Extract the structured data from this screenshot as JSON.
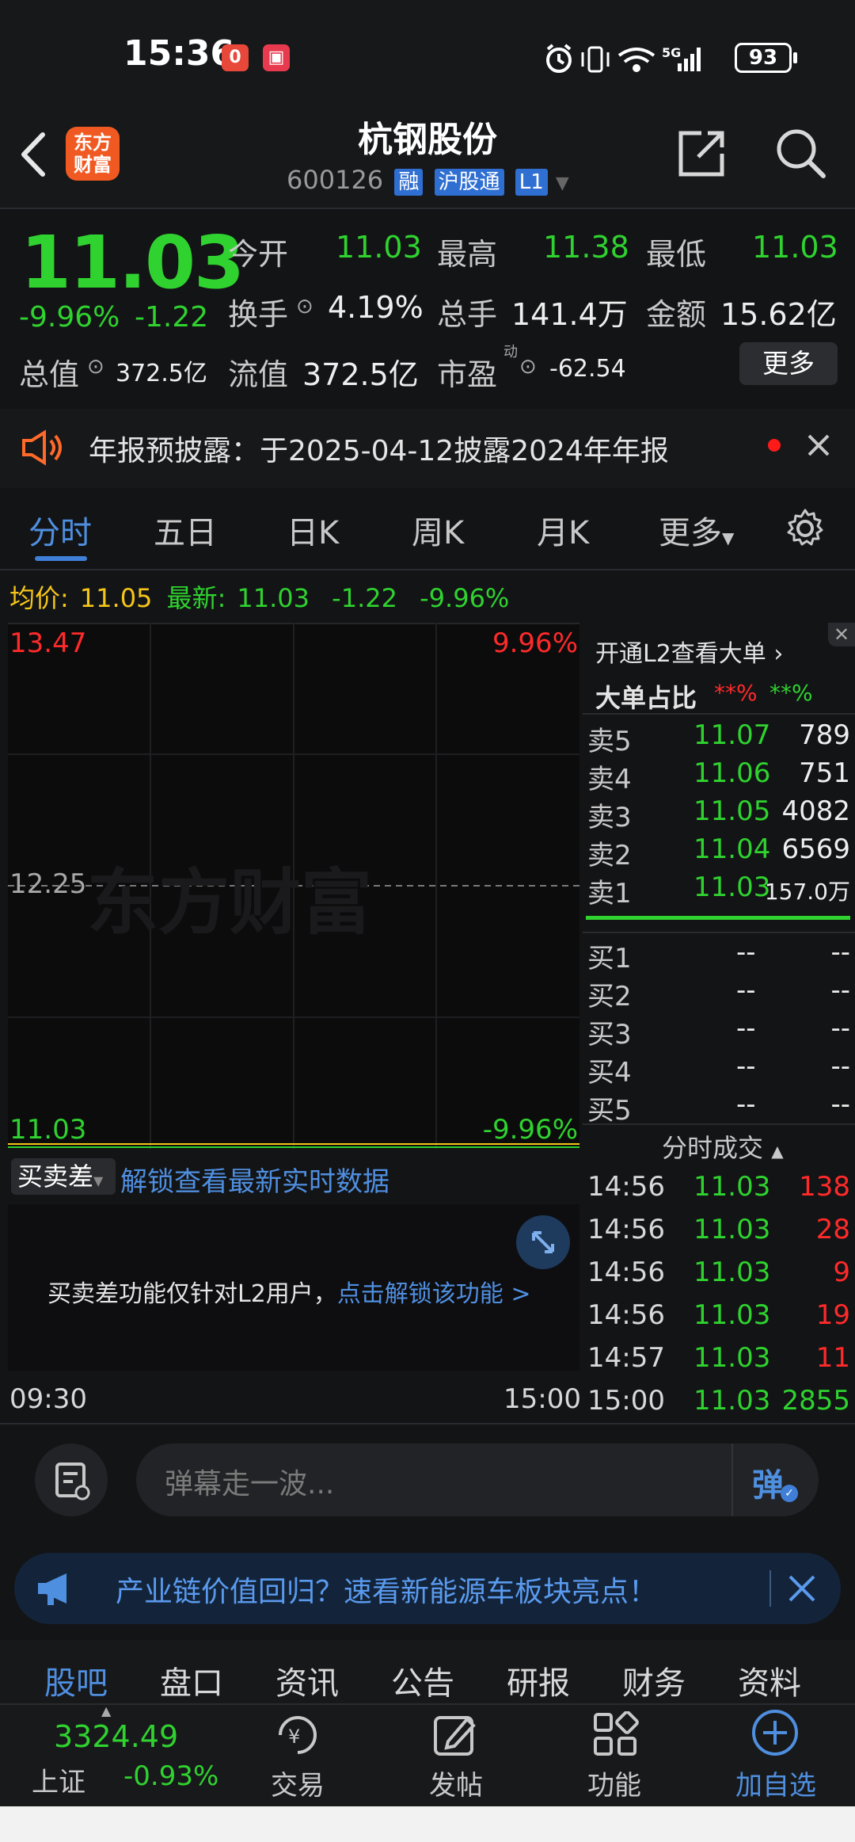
{
  "status": {
    "time": "15:36",
    "battery": "93",
    "network": "5G"
  },
  "header": {
    "title": "杭钢股份",
    "code": "600126",
    "tags": [
      "融",
      "沪股通",
      "L1"
    ],
    "logo_line1": "东方",
    "logo_line2": "财富"
  },
  "quote": {
    "price": "11.03",
    "change_pct": "-9.96%",
    "change": "-1.22",
    "open_label": "今开",
    "open": "11.03",
    "high_label": "最高",
    "high": "11.38",
    "low_label": "最低",
    "low": "11.03",
    "turnover_label": "换手",
    "turnover": "4.19%",
    "volume_label": "总手",
    "volume": "141.4万",
    "amount_label": "金额",
    "amount": "15.62亿",
    "mktcap_label": "总值",
    "mktcap": "372.5亿",
    "float_label": "流值",
    "float": "372.5亿",
    "pe_label": "市盈",
    "pe_sup": "动",
    "pe": "-62.54",
    "more_label": "更多"
  },
  "notice": {
    "text": "年报预披露：于2025-04-12披露2024年年报"
  },
  "chart_tabs": [
    "分时",
    "五日",
    "日K",
    "周K",
    "月K",
    "更多"
  ],
  "intraday": {
    "avg_label": "均价:",
    "avg": "11.05",
    "latest_label": "最新:",
    "latest": "11.03",
    "latest_chg": "-1.22",
    "latest_pct": "-9.96%",
    "top_price": "13.47",
    "top_pct": "9.96%",
    "mid_price": "12.25",
    "bottom_price": "11.03",
    "bottom_pct": "-9.96%",
    "watermark": "东方财富",
    "start_time": "09:30",
    "end_time": "15:00"
  },
  "spread": {
    "label": "买卖差",
    "unlock_link": "解锁查看最新实时数据",
    "info": "买卖差功能仅针对L2用户，",
    "info_link": "点击解锁该功能 >"
  },
  "orderbook": {
    "l2_link": "开通L2查看大单",
    "big_label": "大单占比",
    "big_sell": "**%",
    "big_buy": "**%",
    "asks": [
      {
        "label": "卖5",
        "price": "11.07",
        "vol": "789"
      },
      {
        "label": "卖4",
        "price": "11.06",
        "vol": "751"
      },
      {
        "label": "卖3",
        "price": "11.05",
        "vol": "4082"
      },
      {
        "label": "卖2",
        "price": "11.04",
        "vol": "6569"
      },
      {
        "label": "卖1",
        "price": "11.03",
        "vol": "157.0万"
      }
    ],
    "bids": [
      {
        "label": "买1",
        "price": "--",
        "vol": "--"
      },
      {
        "label": "买2",
        "price": "--",
        "vol": "--"
      },
      {
        "label": "买3",
        "price": "--",
        "vol": "--"
      },
      {
        "label": "买4",
        "price": "--",
        "vol": "--"
      },
      {
        "label": "买5",
        "price": "--",
        "vol": "--"
      }
    ]
  },
  "trades": {
    "title": "分时成交",
    "rows": [
      {
        "time": "14:56",
        "price": "11.03",
        "vol": "138"
      },
      {
        "time": "14:56",
        "price": "11.03",
        "vol": "28"
      },
      {
        "time": "14:56",
        "price": "11.03",
        "vol": "9"
      },
      {
        "time": "14:56",
        "price": "11.03",
        "vol": "19"
      },
      {
        "time": "14:57",
        "price": "11.03",
        "vol": "11"
      },
      {
        "time": "15:00",
        "price": "11.03",
        "vol": "2855"
      }
    ]
  },
  "danmu": {
    "placeholder": "弹幕走一波...",
    "button": "弹"
  },
  "banner": {
    "text": "产业链价值回归？速看新能源车板块亮点！"
  },
  "bottom_tabs": [
    "股吧",
    "盘口",
    "资讯",
    "公告",
    "研报",
    "财务",
    "资料"
  ],
  "bottom_bar": {
    "index_value": "3324.49",
    "index_name": "上证",
    "index_pct": "-0.93%",
    "items": [
      "交易",
      "发帖",
      "功能",
      "加自选"
    ]
  },
  "colors": {
    "up": "#ff2a2a",
    "down": "#2fd22f",
    "accent": "#3f7fd8",
    "brand": "#f05a22"
  }
}
